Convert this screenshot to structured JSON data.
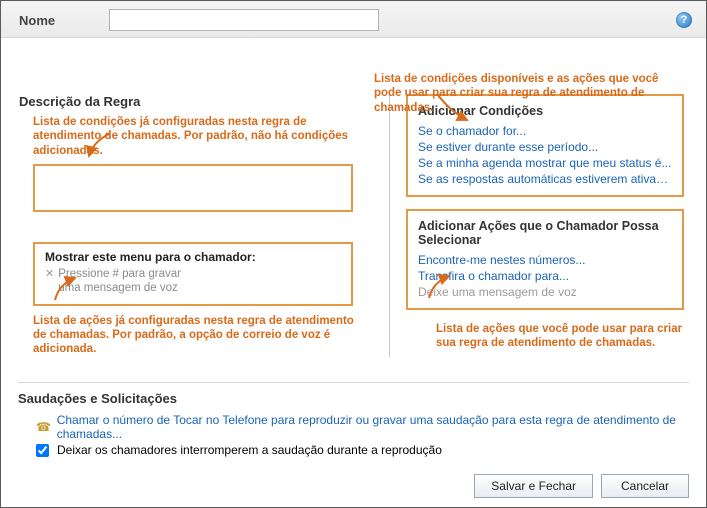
{
  "header": {
    "name_label": "Nome",
    "name_value": ""
  },
  "top_callout": "Lista de condições disponíveis e as ações que você pode usar para criar sua regra de atendimento de chamadas.",
  "left": {
    "section_title": "Descrição da Regra",
    "callout_conditions": "Lista de condições já configuradas nesta regra de atendimento de chamadas. Por padrão, não há condições adicionadas.",
    "menu_title": "Mostrar este menu para o chamador:",
    "voicemail_line1": "Pressione # para gravar",
    "voicemail_line2": "uma mensagem de voz",
    "callout_actions": "Lista de ações já configuradas nesta regra de atendimento de chamadas. Por padrão, a opção de correio de voz é adicionada."
  },
  "right": {
    "conditions_title": "Adicionar Condições",
    "conditions": [
      "Se o chamador for...",
      "Se estiver durante esse período...",
      "Se a minha agenda mostrar que meu status é...",
      "Se as respostas automáticas estiverem ativadas"
    ],
    "actions_title": "Adicionar Ações que o Chamador Possa Selecionar",
    "actions": [
      "Encontre-me nestes números...",
      "Transfira o chamador para..."
    ],
    "actions_disabled": "Deixe uma mensagem de voz",
    "callout_actions_use": "Lista de ações que você pode usar para criar sua regra de atendimento de chamadas."
  },
  "greetings": {
    "title": "Saudações e Solicitações",
    "phone_link": "Chamar o número de Tocar no Telefone para reproduzir ou gravar uma saudação para esta regra de atendimento de chamadas...",
    "interrupt_label": "Deixar os chamadores interromperem a saudação durante a reprodução"
  },
  "buttons": {
    "save": "Salvar e Fechar",
    "cancel": "Cancelar"
  }
}
